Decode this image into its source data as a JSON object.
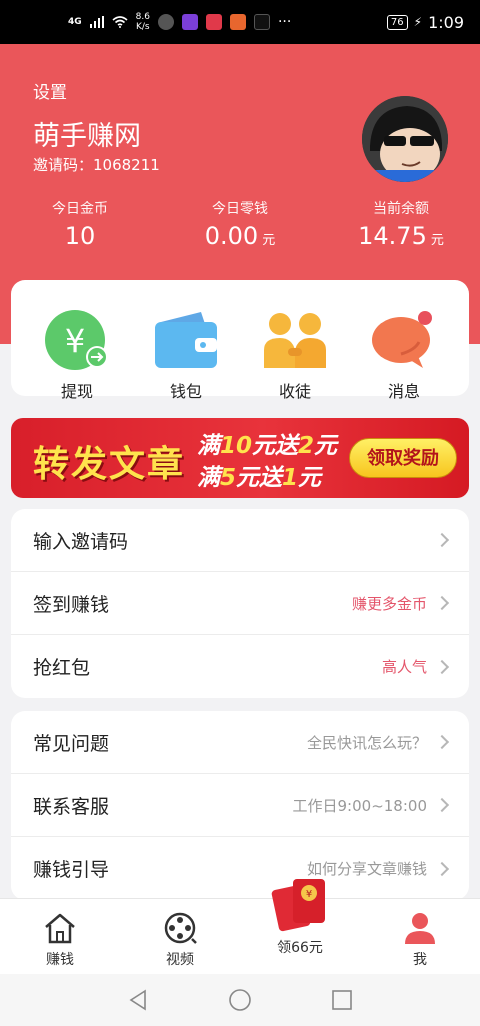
{
  "status": {
    "network": "4G",
    "speed_value": "8.6",
    "speed_unit": "K/s",
    "battery": "76",
    "time": "1:09"
  },
  "header": {
    "settings": "设置",
    "app_name": "萌手赚网",
    "invite_line": "邀请码：1068211"
  },
  "stats": [
    {
      "label": "今日金币",
      "value": "10",
      "unit": ""
    },
    {
      "label": "今日零钱",
      "value": "0.00",
      "unit": "元"
    },
    {
      "label": "当前余额",
      "value": "14.75",
      "unit": "元"
    }
  ],
  "quick_actions": [
    {
      "label": "提现",
      "icon": "yuan-withdraw-icon"
    },
    {
      "label": "钱包",
      "icon": "wallet-icon"
    },
    {
      "label": "收徒",
      "icon": "people-icon"
    },
    {
      "label": "消息",
      "icon": "message-icon"
    }
  ],
  "banner": {
    "title": "转发文章",
    "line1_a": "满",
    "line1_b": "10",
    "line1_c": "元送",
    "line1_d": "2",
    "line1_e": "元",
    "line2_a": "满",
    "line2_b": "5",
    "line2_c": "元送",
    "line2_d": "1",
    "line2_e": "元",
    "button": "领取奖励"
  },
  "menu_group_1": [
    {
      "label": "输入邀请码",
      "hint": ""
    },
    {
      "label": "签到赚钱",
      "hint": "赚更多金币"
    },
    {
      "label": "抢红包",
      "hint": "高人气"
    }
  ],
  "menu_group_2": [
    {
      "label": "常见问题",
      "hint": "全民快讯怎么玩？"
    },
    {
      "label": "联系客服",
      "hint": "工作日9:00~18:00"
    },
    {
      "label": "赚钱引导",
      "hint": "如何分享文章赚钱"
    }
  ],
  "tabs": [
    {
      "label": "赚钱",
      "icon": "home-icon"
    },
    {
      "label": "视频",
      "icon": "film-reel-icon"
    },
    {
      "label": "领66元",
      "icon": "red-envelope-icon"
    },
    {
      "label": "我",
      "icon": "user-icon"
    }
  ],
  "colors": {
    "primary_red": "#ea565a",
    "hint_red": "#e4566b",
    "banner_yellow": "#ffe34d"
  }
}
